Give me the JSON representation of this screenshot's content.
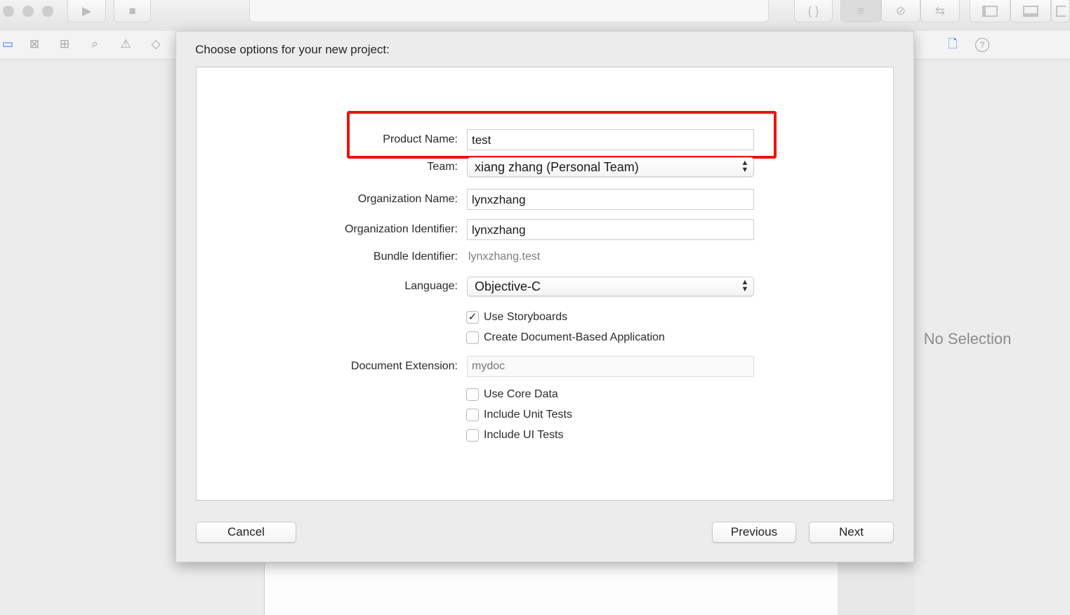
{
  "sheet": {
    "title": "Choose options for your new project:",
    "form": {
      "product_name": {
        "label": "Product Name:",
        "value": "test"
      },
      "team": {
        "label": "Team:",
        "value": "xiang zhang (Personal Team)"
      },
      "organization_name": {
        "label": "Organization Name:",
        "value": "lynxzhang"
      },
      "organization_identifier": {
        "label": "Organization Identifier:",
        "value": "lynxzhang"
      },
      "bundle_identifier": {
        "label": "Bundle Identifier:",
        "value": "lynxzhang.test"
      },
      "language": {
        "label": "Language:",
        "value": "Objective-C"
      },
      "use_storyboards": {
        "label": "Use Storyboards",
        "checked": true,
        "mark": "✓"
      },
      "create_document_based": {
        "label": "Create Document-Based Application",
        "checked": false
      },
      "document_extension": {
        "label": "Document Extension:",
        "value": "",
        "placeholder": "mydoc"
      },
      "use_core_data": {
        "label": "Use Core Data",
        "checked": false
      },
      "include_unit_tests": {
        "label": "Include Unit Tests",
        "checked": false
      },
      "include_ui_tests": {
        "label": "Include UI Tests",
        "checked": false
      }
    },
    "buttons": {
      "cancel": "Cancel",
      "previous": "Previous",
      "next": "Next"
    },
    "highlight_color": "#ee1111"
  },
  "inspector": {
    "empty_text": "No Selection"
  },
  "icons": {
    "play": "▶",
    "stop": "■",
    "braces": "{ }",
    "editor": "≡",
    "link": "⊘",
    "arrows": "⇆",
    "folder": "▭",
    "x_box": "⊠",
    "hierarchy": "⊞",
    "search": "⌕",
    "warning": "⚠",
    "tag": "◇",
    "file": "🗋",
    "help": "?"
  }
}
